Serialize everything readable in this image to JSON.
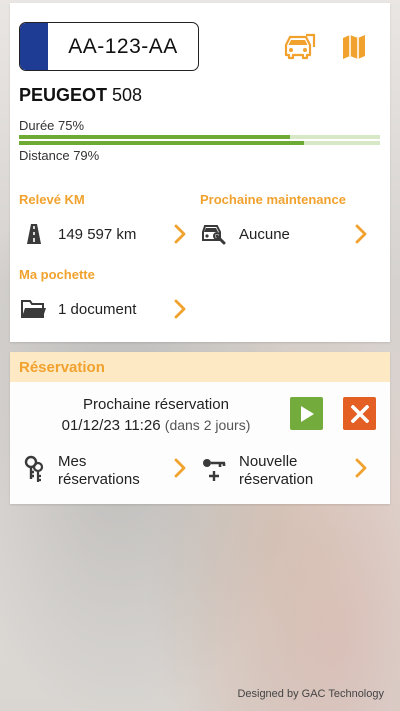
{
  "vehicle": {
    "plate": "AA-123-AA",
    "brand": "PEUGEOT",
    "model": "508",
    "duration_label": "Durée 75%",
    "duration_progress": 0.75,
    "distance_label": "Distance 79%",
    "distance_progress": 0.79,
    "icons": {
      "car": "car-icon",
      "map": "map-icon"
    }
  },
  "mileage": {
    "title": "Relevé KM",
    "value": "149 597 km",
    "icon": "road-icon"
  },
  "maintenance": {
    "title": "Prochaine maintenance",
    "value": "Aucune",
    "icon": "car-wrench-icon"
  },
  "pouch": {
    "title": "Ma pochette",
    "value": "1 document",
    "icon": "folder-icon"
  },
  "reservation": {
    "header": "Réservation",
    "next_label": "Prochaine réservation",
    "next_datetime": "01/12/23 11:26",
    "next_relative": "(dans 2 jours)",
    "my_reservations_line1": "Mes",
    "my_reservations_line2": "réservations",
    "new_reservation_line1": "Nouvelle",
    "new_reservation_line2": "réservation"
  },
  "footer": {
    "credit": "Designed by GAC Technology"
  },
  "colors": {
    "accent": "#f1a22e",
    "progress": "#6eab35",
    "plate_band": "#1f3c94",
    "start_button": "#73ac3d",
    "cancel_button": "#e35f24",
    "reservation_header_bg": "#fde9c4"
  }
}
